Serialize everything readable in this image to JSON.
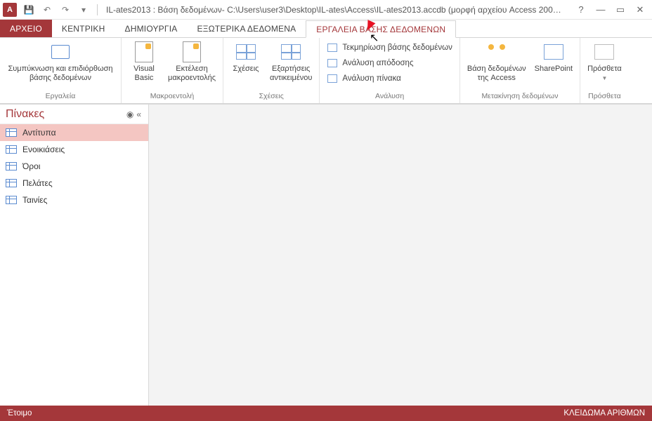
{
  "titlebar": {
    "app_badge": "A",
    "title": "IL-ates2013 : Βάση δεδομένων- C:\\Users\\user3\\Desktop\\IL-ates\\Access\\IL-ates2013.accdb (μορφή αρχείου Access 200…"
  },
  "tabs": {
    "file": "ΑΡΧΕΙΟ",
    "home": "ΚΕΝΤΡΙΚΗ",
    "create": "ΔΗΜΙΟΥΡΓΙΑ",
    "external": "ΕΞΩΤΕΡΙΚΑ ΔΕΔΟΜΕΝΑ",
    "dbtools": "ΕΡΓΑΛΕΙΑ ΒΑΣΗΣ ΔΕΔΟΜΕΝΩΝ"
  },
  "ribbon": {
    "tools": {
      "compact": "Συμπύκνωση και επιδιόρθωση\nβάσης δεδομένων",
      "group": "Εργαλεία"
    },
    "macro": {
      "vb": "Visual\nBasic",
      "run": "Εκτέλεση\nμακροεντολής",
      "group": "Μακροεντολή"
    },
    "relations": {
      "rel": "Σχέσεις",
      "deps": "Εξαρτήσεις\nαντικειμένου",
      "group": "Σχέσεις"
    },
    "analyze": {
      "docu": "Τεκμηρίωση βάσης δεδομένων",
      "perf": "Ανάλυση απόδοσης",
      "table": "Ανάλυση πίνακα",
      "group": "Ανάλυση"
    },
    "move": {
      "access": "Βάση δεδομένων\nτης Access",
      "sharepoint": "SharePoint",
      "group": "Μετακίνηση δεδομένων"
    },
    "addins": {
      "btn": "Πρόσθετα",
      "group": "Πρόσθετα"
    }
  },
  "nav": {
    "header": "Πίνακες",
    "items": [
      "Αντίτυπα",
      "Ενοικιάσεις",
      "Όροι",
      "Πελάτες",
      "Ταινίες"
    ],
    "selected_index": 0
  },
  "status": {
    "ready": "Έτοιμο",
    "numlock": "ΚΛΕΙΔΩΜΑ ΑΡΙΘΜΩΝ"
  }
}
